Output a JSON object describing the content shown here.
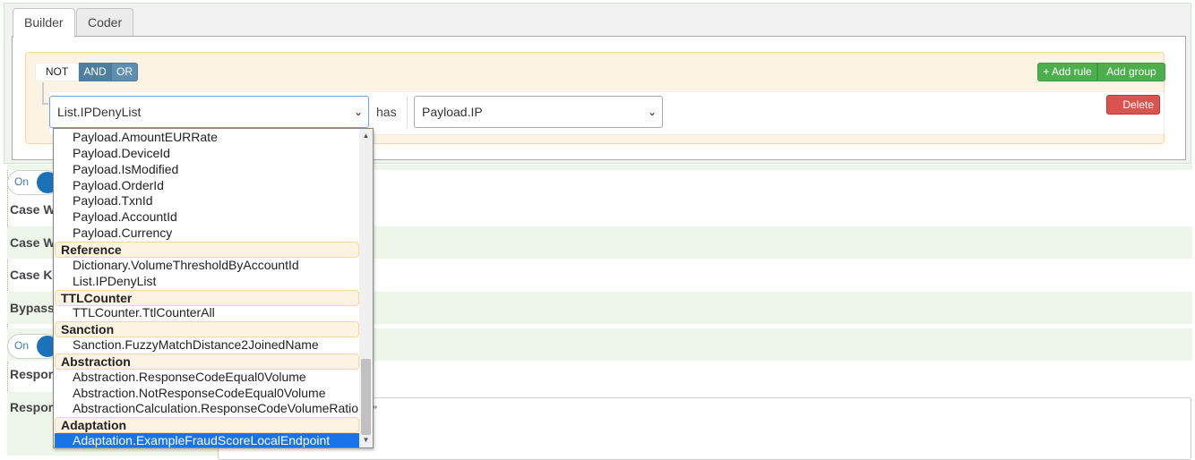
{
  "tabs": [
    {
      "label": "Builder",
      "active": true
    },
    {
      "label": "Coder",
      "active": false
    }
  ],
  "group": {
    "not_label": "NOT",
    "and_label": "AND",
    "or_label": "OR",
    "add_rule_label": "+ Add rule",
    "add_group_label": "Add group",
    "delete_label": "Delete"
  },
  "rule": {
    "field_value": "List.IPDenyList",
    "operator": "has",
    "value": "Payload.IP"
  },
  "settings": {
    "toggle1_label": "On",
    "toggle2_label": "On",
    "rows": [
      {
        "label": "Case W"
      },
      {
        "label": "Case W"
      },
      {
        "label": "Case K"
      },
      {
        "label": "Bypass"
      },
      {
        "label": "Respor"
      },
      {
        "label": "Respor"
      }
    ],
    "textarea_fragment": "\""
  },
  "dropdown": {
    "items": [
      {
        "label": "Payload.AmountEURRate",
        "type": "option"
      },
      {
        "label": "Payload.DeviceId",
        "type": "option"
      },
      {
        "label": "Payload.IsModified",
        "type": "option"
      },
      {
        "label": "Payload.OrderId",
        "type": "option"
      },
      {
        "label": "Payload.TxnId",
        "type": "option"
      },
      {
        "label": "Payload.AccountId",
        "type": "option"
      },
      {
        "label": "Payload.Currency",
        "type": "option"
      },
      {
        "label": "Reference",
        "type": "group"
      },
      {
        "label": "Dictionary.VolumeThresholdByAccountId",
        "type": "option"
      },
      {
        "label": "List.IPDenyList",
        "type": "option"
      },
      {
        "label": "TTLCounter",
        "type": "group"
      },
      {
        "label": "TTLCounter.TtlCounterAll",
        "type": "option"
      },
      {
        "label": "Sanction",
        "type": "group"
      },
      {
        "label": "Sanction.FuzzyMatchDistance2JoinedName",
        "type": "option"
      },
      {
        "label": "Abstraction",
        "type": "group"
      },
      {
        "label": "Abstraction.ResponseCodeEqual0Volume",
        "type": "option"
      },
      {
        "label": "Abstraction.NotResponseCodeEqual0Volume",
        "type": "option"
      },
      {
        "label": "AbstractionCalculation.ResponseCodeVolumeRatio",
        "type": "option"
      },
      {
        "label": "Adaptation",
        "type": "group"
      },
      {
        "label": "Adaptation.ExampleFraudScoreLocalEndpoint",
        "type": "option",
        "selected": true
      }
    ]
  },
  "colors": {
    "accent": "#1a73e8",
    "and_button": "#4e7f9f",
    "add_button": "#4cae4c",
    "delete_button": "#d9534f",
    "group_bg": "#fcf3e3"
  }
}
